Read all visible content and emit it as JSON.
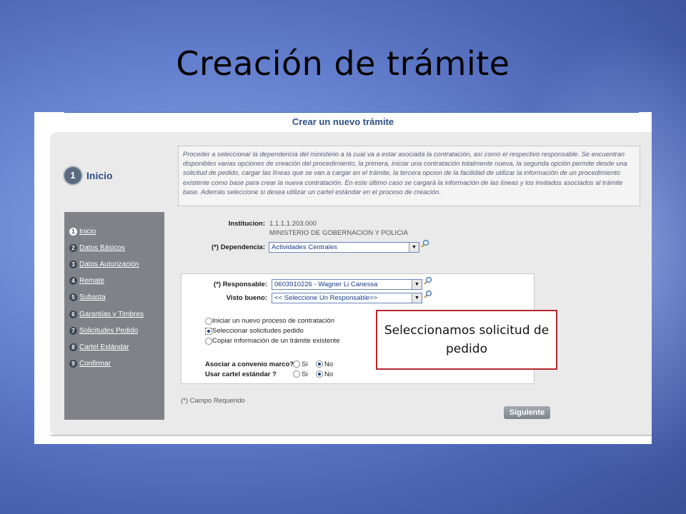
{
  "slide": {
    "title": "Creación de trámite",
    "callout": "Seleccionamos solicitud de pedido"
  },
  "page": {
    "heading": "Crear un nuevo trámite",
    "step_number": "1",
    "step_title": "Inicio",
    "description": "Proceder a seleccionar la dependencia del ministerio a la cual va a estar asociada la contratación, así como el respectivo responsable. Se encuentran disponibles varias opciones de creación del procedimiento, la primera, iniciar una contratación totalmente nueva, la segunda opción permite desde una solicitud de pedido, cargar las líneas que se van a cargar en el trámite, la tercera opcion de la facilidad de utilizar la información de un procedimiento existente como base para crear la nueva contratación. En este último caso se cargará la información de las líneas y los invitados asociados al trámite base. Además seleccione si desea utilizar un cartel estándar en el proceso de creación."
  },
  "sidebar": {
    "items": [
      {
        "num": "1",
        "label": "Inicio"
      },
      {
        "num": "2",
        "label": "Datos Básicos"
      },
      {
        "num": "3",
        "label": "Datos Autorización"
      },
      {
        "num": "4",
        "label": "Remate"
      },
      {
        "num": "5",
        "label": "Subasta"
      },
      {
        "num": "6",
        "label": "Garantías y Timbres"
      },
      {
        "num": "7",
        "label": "Solicitudes Pedido"
      },
      {
        "num": "8",
        "label": "Cartel Estándar"
      },
      {
        "num": "9",
        "label": "Confirmar"
      }
    ]
  },
  "form": {
    "institucion_label": "Institucion:",
    "institucion_code": "1.1.1.1.203.000",
    "institucion_name": "MINISTERIO DE GOBERNACION Y POLICIA",
    "dependencia_label": "(*) Dependencia:",
    "dependencia_value": "Actividades Centrales",
    "responsable_label": "(*) Responsable:",
    "responsable_value": "0603910226 - Wagner Li Canessa",
    "visto_label": "Visto bueno:",
    "visto_value": "<< Seleccione Un Responsable>>",
    "options": [
      {
        "label": "Iniciar un nuevo proceso de contratación",
        "selected": false
      },
      {
        "label": "Seleccionar solicitudes pedido",
        "selected": true
      },
      {
        "label": "Copiar información de un trámite existente",
        "selected": false
      }
    ],
    "convenio_label": "Asociar a convenio marco?",
    "cartel_label": "Usar cartel estándar ?",
    "si": "Si",
    "no": "No",
    "required_note": "(*) Campo Requerido",
    "next_button": "Siguiente"
  }
}
